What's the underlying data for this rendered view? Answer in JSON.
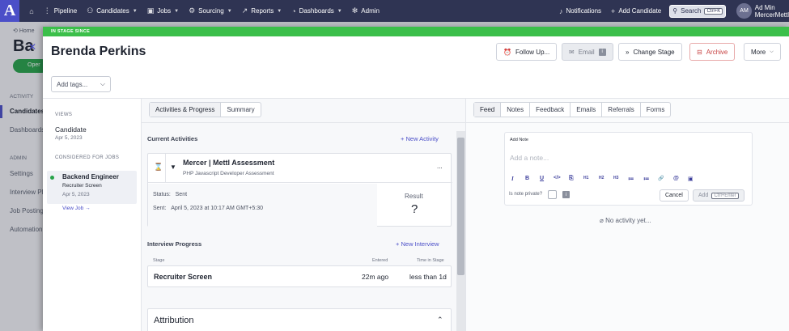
{
  "nav": {
    "logo": "A",
    "items": [
      {
        "label": "Pipeline",
        "icon": "pipeline-icon"
      },
      {
        "label": "Candidates",
        "icon": "users-icon"
      },
      {
        "label": "Jobs",
        "icon": "briefcase-icon"
      },
      {
        "label": "Sourcing",
        "icon": "sourcing-icon"
      },
      {
        "label": "Reports",
        "icon": "reports-icon"
      },
      {
        "label": "Dashboards",
        "icon": "dashboard-icon"
      },
      {
        "label": "Admin",
        "icon": "gear-icon"
      }
    ],
    "notifications": "Notifications",
    "add_candidate": "Add Candidate",
    "search_label": "Search",
    "search_kbd": "Ctrl+K",
    "avatar": "AM",
    "user_name": "Ad Min",
    "user_org": "MercerMettl"
  },
  "background": {
    "breadcrumb": "Home",
    "title": "Ba",
    "status": "Oper",
    "sections": {
      "activity": "ACTIVITY",
      "admin": "ADMIN"
    },
    "items": [
      "Candidates",
      "Dashboards",
      "Settings",
      "Interview Pl",
      "Job Postings",
      "Automation"
    ]
  },
  "panel": {
    "stage_banner": "IN STAGE SINCE",
    "candidate_name": "Brenda Perkins",
    "actions": {
      "follow_up": "Follow Up...",
      "email": "Email",
      "change_stage": "Change Stage",
      "archive": "Archive",
      "more": "More"
    },
    "tags_placeholder": "Add tags..."
  },
  "left": {
    "views_label": "VIEWS",
    "view_name": "Candidate",
    "view_date": "Apr 5, 2023",
    "considered_label": "CONSIDERED FOR JOBS",
    "job": {
      "title": "Backend Engineer",
      "stage": "Recruiter Screen",
      "date": "Apr 5, 2023",
      "link": "View Job"
    }
  },
  "center": {
    "tabs": [
      "Activities & Progress",
      "Summary"
    ],
    "current_activities": "Current Activities",
    "new_activity": "New Activity",
    "assessment": {
      "title": "Mercer | Mettl Assessment",
      "subtitle": "PHP Javascript Developer Assessment",
      "status_label": "Status:",
      "status_value": "Sent",
      "sent_label": "Sent:",
      "sent_value": "April 5, 2023 at 10:17 AM GMT+5:30",
      "result_label": "Result",
      "result_value": "?",
      "menu": "..."
    },
    "interview_progress": "Interview Progress",
    "new_interview": "New Interview",
    "table": {
      "headers": [
        "Stage",
        "Entered",
        "Time in Stage"
      ],
      "row": [
        "Recruiter Screen",
        "22m ago",
        "less than 1d"
      ]
    },
    "attribution": "Attribution"
  },
  "right": {
    "tabs": [
      "Feed",
      "Notes",
      "Feedback",
      "Emails",
      "Referrals",
      "Forms"
    ],
    "add_note": "Add Note",
    "note_placeholder": "Add a note...",
    "private_label": "Is note private?",
    "cancel": "Cancel",
    "add": "Add",
    "add_kbd": "Ctrl+Enter",
    "empty": "No activity yet...",
    "toolbar": [
      "I",
      "B",
      "U",
      "</>",
      "⎘",
      "H1",
      "H2",
      "H3",
      "≔",
      "≔",
      "🔗",
      "@",
      "▣"
    ]
  }
}
